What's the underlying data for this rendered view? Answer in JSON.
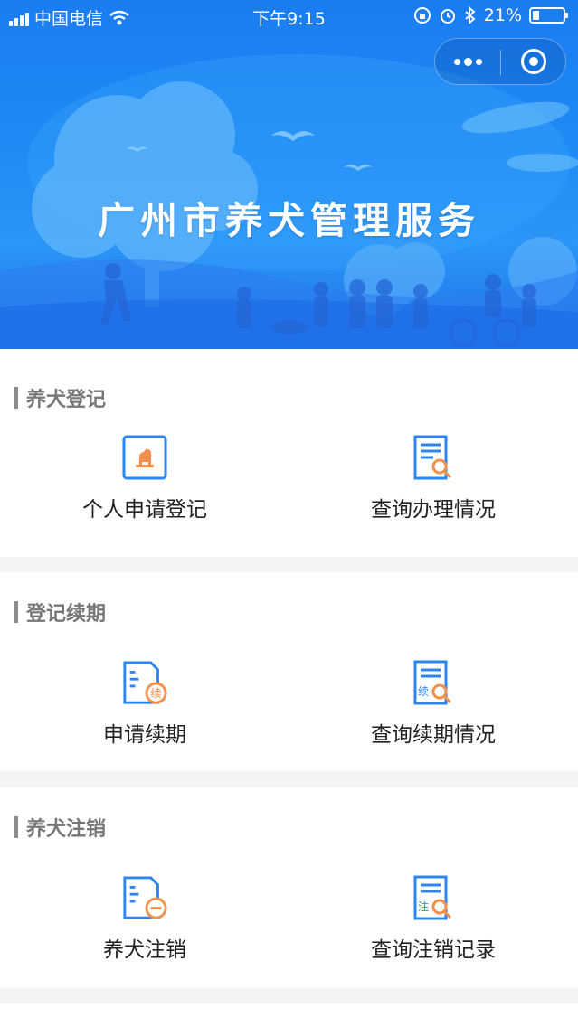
{
  "status_bar": {
    "carrier": "中国电信",
    "time": "下午9:15",
    "battery": "21%",
    "battery_level": 0.21
  },
  "banner": {
    "title": "广州市养犬管理服务"
  },
  "capsule": {
    "more_icon": "more-dots-icon",
    "close_icon": "target-close-icon"
  },
  "sections": [
    {
      "title": "养犬登记",
      "items": [
        {
          "label": "个人申请登记",
          "icon": "dog-register-icon"
        },
        {
          "label": "查询办理情况",
          "icon": "search-document-icon"
        }
      ]
    },
    {
      "title": "登记续期",
      "items": [
        {
          "label": "申请续期",
          "icon": "renew-document-icon",
          "badge": "续"
        },
        {
          "label": "查询续期情况",
          "icon": "search-renew-icon",
          "badge": "续"
        }
      ]
    },
    {
      "title": "养犬注销",
      "items": [
        {
          "label": "养犬注销",
          "icon": "cancel-document-icon"
        },
        {
          "label": "查询注销记录",
          "icon": "search-cancel-icon",
          "badge": "注"
        }
      ]
    }
  ],
  "colors": {
    "primary_blue": "#1a7df2",
    "icon_blue": "#2b86f2",
    "icon_orange": "#f5904a",
    "section_bar": "#8c8c8c",
    "page_bg": "#f4f4f4"
  }
}
